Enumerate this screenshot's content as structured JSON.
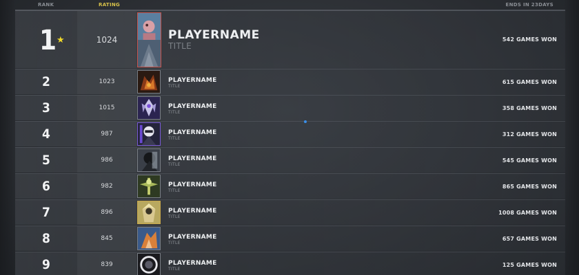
{
  "header": {
    "rank_label": "RANK",
    "rating_label": "RATING",
    "ends_label": "ENDS IN 23DAYS"
  },
  "colors": {
    "accent_gold": "#d8c24a",
    "star": "#f2da2a",
    "first_portrait_border": "#c8534b",
    "cursor_dot": "#3b8fe8"
  },
  "leaderboard": [
    {
      "rank": "1",
      "rating": "1024",
      "name": "PLAYERNAME",
      "title": "TITLE",
      "games": "542 GAMES WON",
      "icon": "star-icon"
    },
    {
      "rank": "2",
      "rating": "1023",
      "name": "PLAYERNAME",
      "title": "TITLE",
      "games": "615 GAMES WON"
    },
    {
      "rank": "3",
      "rating": "1015",
      "name": "PLAYERNAME",
      "title": "TITLE",
      "games": "358 GAMES WON"
    },
    {
      "rank": "4",
      "rating": "987",
      "name": "PLAYERNAME",
      "title": "TITLE",
      "games": "312 GAMES WON"
    },
    {
      "rank": "5",
      "rating": "986",
      "name": "PLAYERNAME",
      "title": "TITLE",
      "games": "545 GAMES WON"
    },
    {
      "rank": "6",
      "rating": "982",
      "name": "PLAYERNAME",
      "title": "TITLE",
      "games": "865 GAMES WON"
    },
    {
      "rank": "7",
      "rating": "896",
      "name": "PLAYERNAME",
      "title": "TITLE",
      "games": "1008 GAMES WON"
    },
    {
      "rank": "8",
      "rating": "845",
      "name": "PLAYERNAME",
      "title": "TITLE",
      "games": "657 GAMES WON"
    },
    {
      "rank": "9",
      "rating": "839",
      "name": "PLAYERNAME",
      "title": "TITLE",
      "games": "125 GAMES WON"
    }
  ]
}
